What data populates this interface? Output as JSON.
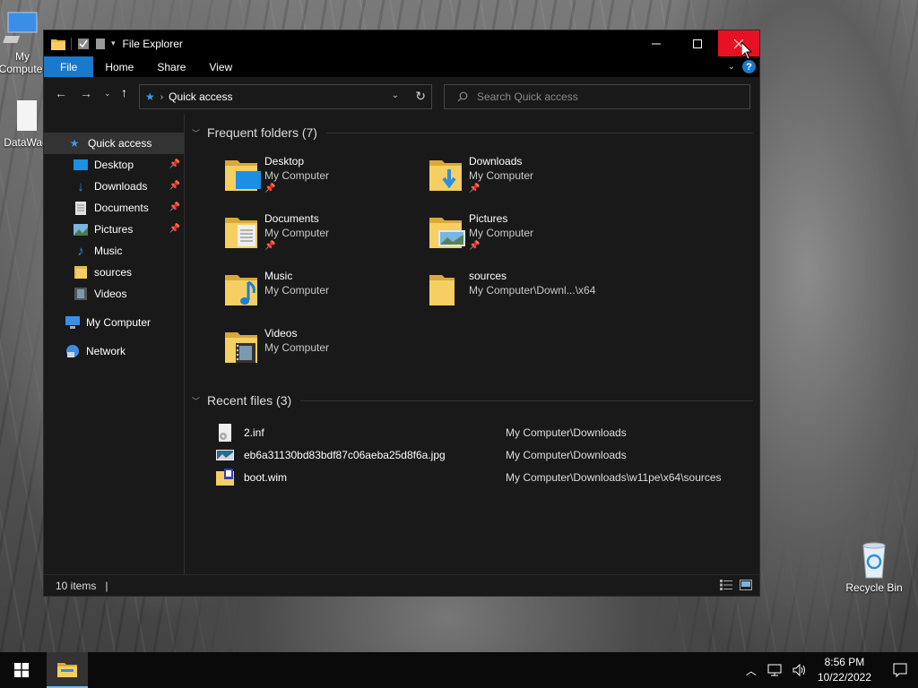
{
  "desktop": {
    "icons": [
      {
        "label": "My Computer"
      },
      {
        "label": "DataWag"
      },
      {
        "label": "Recycle Bin"
      }
    ]
  },
  "window": {
    "title": "File Explorer",
    "tabs": [
      "File",
      "Home",
      "Share",
      "View"
    ]
  },
  "address": {
    "location": "Quick access"
  },
  "search": {
    "placeholder": "Search Quick access"
  },
  "nav_pane": {
    "items": [
      {
        "label": "Quick access",
        "icon": "star-icon"
      },
      {
        "label": "Desktop",
        "icon": "desktop-icon",
        "pinned": true
      },
      {
        "label": "Downloads",
        "icon": "downloads-icon",
        "pinned": true
      },
      {
        "label": "Documents",
        "icon": "documents-icon",
        "pinned": true
      },
      {
        "label": "Pictures",
        "icon": "pictures-icon",
        "pinned": true
      },
      {
        "label": "Music",
        "icon": "music-icon"
      },
      {
        "label": "sources",
        "icon": "folder-icon"
      },
      {
        "label": "Videos",
        "icon": "videos-icon"
      },
      {
        "label": "My Computer",
        "icon": "computer-icon"
      },
      {
        "label": "Network",
        "icon": "network-icon"
      }
    ]
  },
  "frequent": {
    "header": "Frequent folders (7)",
    "folders": [
      {
        "name": "Desktop",
        "location": "My Computer",
        "pinned": true
      },
      {
        "name": "Downloads",
        "location": "My Computer",
        "pinned": true
      },
      {
        "name": "Documents",
        "location": "My Computer",
        "pinned": true
      },
      {
        "name": "Pictures",
        "location": "My Computer",
        "pinned": true
      },
      {
        "name": "Music",
        "location": "My Computer",
        "pinned": false
      },
      {
        "name": "sources",
        "location": "My Computer\\Downl...\\x64",
        "pinned": false
      },
      {
        "name": "Videos",
        "location": "My Computer",
        "pinned": false
      }
    ]
  },
  "recent": {
    "header": "Recent files (3)",
    "files": [
      {
        "name": "2.inf",
        "path": "My Computer\\Downloads"
      },
      {
        "name": "eb6a31130bd83bdf87c06aeba25d8f6a.jpg",
        "path": "My Computer\\Downloads"
      },
      {
        "name": "boot.wim",
        "path": "My Computer\\Downloads\\w11pe\\x64\\sources"
      }
    ]
  },
  "status": {
    "item_count": "10 items"
  },
  "taskbar": {
    "time": "8:56 PM",
    "date": "10/22/2022"
  },
  "colors": {
    "accent": "#1979ca",
    "close_hover": "#e81123",
    "folder": "#e8b84a"
  }
}
